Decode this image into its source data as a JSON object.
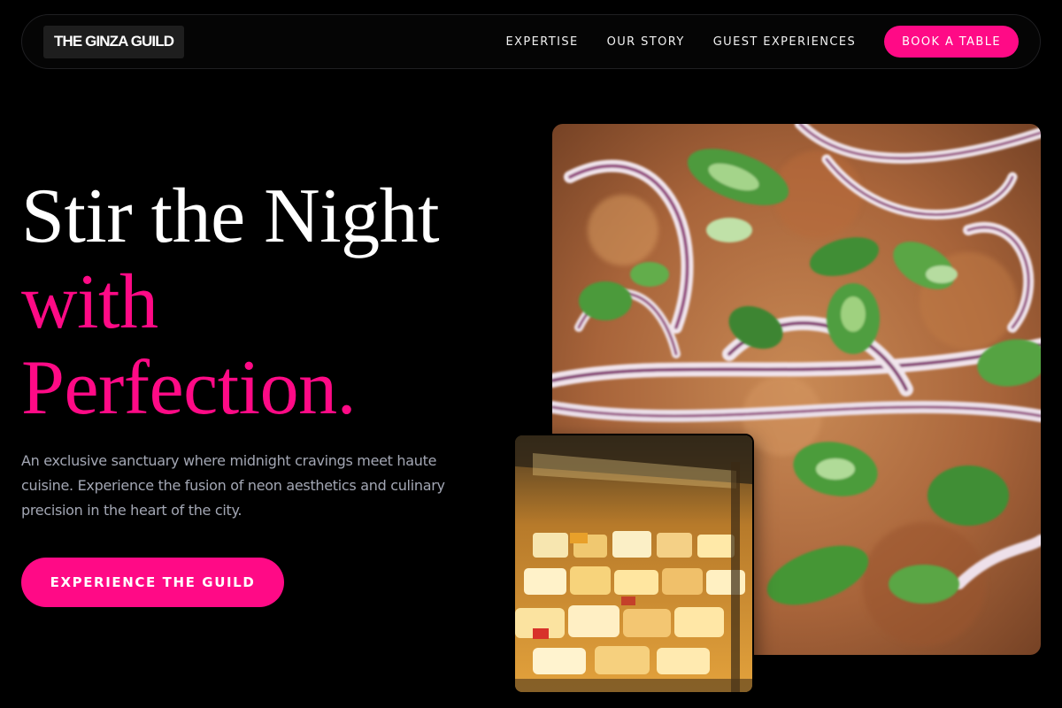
{
  "brand": {
    "name": "THE GINZA GUILD"
  },
  "nav": {
    "links": [
      "EXPERTISE",
      "OUR STORY",
      "GUEST EXPERIENCES"
    ],
    "cta": "BOOK A TABLE"
  },
  "hero": {
    "title_line1": "Stir the Night",
    "title_line2": "with",
    "title_line3": "Perfection.",
    "description": "An exclusive sanctuary where midnight cravings meet haute cuisine. Experience the fusion of neon aesthetics and culinary precision in the heart of the city.",
    "cta": "EXPERIENCE THE GUILD"
  },
  "images": {
    "main": "pizza-with-red-onion-and-scallions",
    "secondary": "cheese-display-case"
  },
  "colors": {
    "accent": "#ff0a86",
    "background": "#000000",
    "muted_text": "#a3a7b4"
  }
}
